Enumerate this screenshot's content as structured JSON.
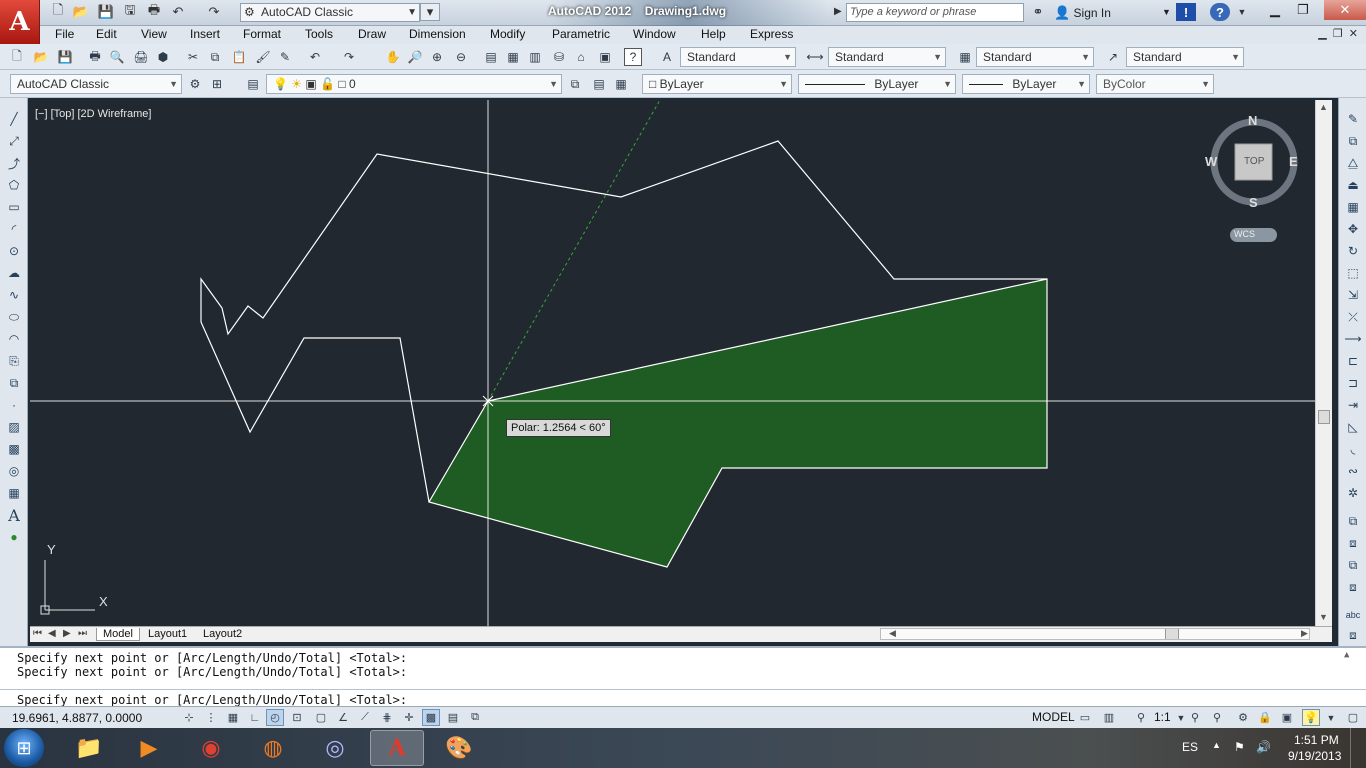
{
  "titlebar": {
    "workspace": "AutoCAD Classic",
    "app_title": "AutoCAD 2012",
    "doc_title": "Drawing1.dwg",
    "search_placeholder": "Type a keyword or phrase",
    "signin": "Sign In"
  },
  "menu": [
    "File",
    "Edit",
    "View",
    "Insert",
    "Format",
    "Tools",
    "Draw",
    "Dimension",
    "Modify",
    "Parametric",
    "Window",
    "Help",
    "Express"
  ],
  "styles_toolbar": {
    "text_style": "Standard",
    "dim_style": "Standard",
    "table_style": "Standard",
    "mleader_style": "Standard"
  },
  "layers_toolbar": {
    "workspace": "AutoCAD Classic",
    "current_layer": "0",
    "color": "ByLayer",
    "linetype": "ByLayer",
    "lineweight": "ByLayer",
    "plot_style": "ByColor"
  },
  "viewport": {
    "label": "[−] [Top] [2D Wireframe]",
    "viewcube": {
      "north": "N",
      "south": "S",
      "east": "E",
      "west": "W",
      "face": "TOP",
      "wcs": "WCS"
    },
    "ucs": {
      "x": "X",
      "y": "Y"
    },
    "polar_tooltip": "Polar: 1.2564 < 60°",
    "hatch_color": "#1e5c23",
    "linework_color": "#ffffff"
  },
  "tabs": [
    "Model",
    "Layout1",
    "Layout2"
  ],
  "command_line": {
    "history": [
      "Specify next point or [Arc/Length/Undo/Total] <Total>:",
      "Specify next point or [Arc/Length/Undo/Total] <Total>:"
    ],
    "prompt": "Specify next point or [Arc/Length/Undo/Total] <Total>:"
  },
  "statusbar": {
    "coordinates": "19.6961, 4.8877, 0.0000",
    "model": "MODEL",
    "annotation_scale": "1:1"
  },
  "taskbar": {
    "language": "ES",
    "time": "1:51 PM",
    "date": "9/19/2013"
  }
}
